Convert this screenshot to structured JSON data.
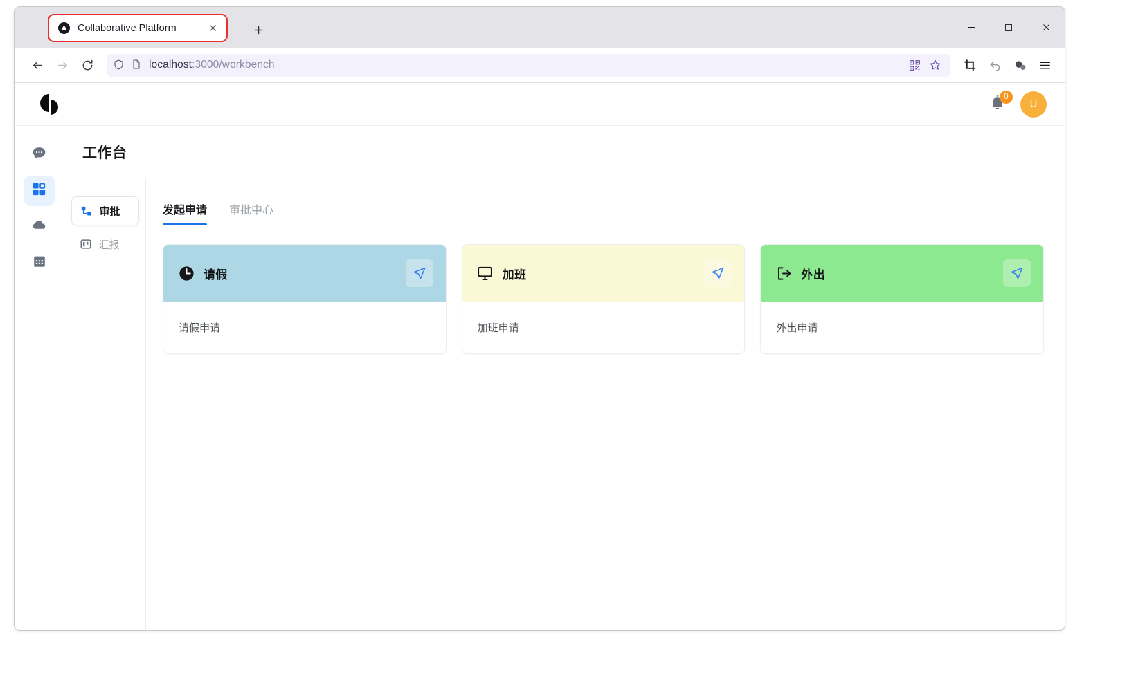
{
  "browser": {
    "tab": {
      "title": "Collaborative Platform",
      "favicon": "triangle-circle-icon",
      "close": "×"
    },
    "newtab_label": "+",
    "window_controls": {
      "minimize": "–",
      "maximize": "□",
      "close": "✕"
    },
    "nav": {
      "back": "←",
      "forward": "→",
      "reload": "⟳"
    },
    "url": {
      "protocol_host": "localhost",
      "path": ":3000/workbench",
      "full": "localhost:3000/workbench"
    },
    "url_icons": [
      "shield-icon",
      "page-icon"
    ],
    "url_right_icons": [
      "qr-code-icon",
      "bookmark-star-icon"
    ],
    "toolbar_icons": [
      "crop-icon",
      "undo-icon",
      "extension-icon",
      "menu-icon"
    ]
  },
  "app": {
    "logo": "split-circle-logo",
    "notifications": {
      "icon": "bell-icon",
      "count": "0",
      "badge_color": "#f7941d"
    },
    "avatar": {
      "initial": "U",
      "color": "#f9b03a"
    },
    "page_title": "工作台",
    "rail": [
      {
        "name": "messages",
        "icon": "chat-bubble-icon",
        "active": false
      },
      {
        "name": "workbench",
        "icon": "grid-apps-icon",
        "active": true
      },
      {
        "name": "cloud",
        "icon": "cloud-icon",
        "active": false
      },
      {
        "name": "calendar",
        "icon": "calendar-grid-icon",
        "active": false
      }
    ],
    "subnav": [
      {
        "label": "审批",
        "icon": "flow-branch-icon",
        "active": true
      },
      {
        "label": "汇报",
        "icon": "board-icon",
        "active": false
      }
    ],
    "tabs": [
      {
        "label": "发起申请",
        "active": true
      },
      {
        "label": "审批中心",
        "active": false
      }
    ],
    "cards": [
      {
        "title": "请假",
        "desc": "请假申请",
        "icon": "clock-icon",
        "header_color": "#aed7e5",
        "send_icon": "send-plane-icon"
      },
      {
        "title": "加班",
        "desc": "加班申请",
        "icon": "monitor-icon",
        "header_color": "#faf8d5",
        "send_icon": "send-plane-icon"
      },
      {
        "title": "外出",
        "desc": "外出申请",
        "icon": "exit-arrow-icon",
        "header_color": "#8ce98f",
        "send_icon": "send-plane-icon"
      }
    ],
    "accent_color": "#1a73e8"
  }
}
